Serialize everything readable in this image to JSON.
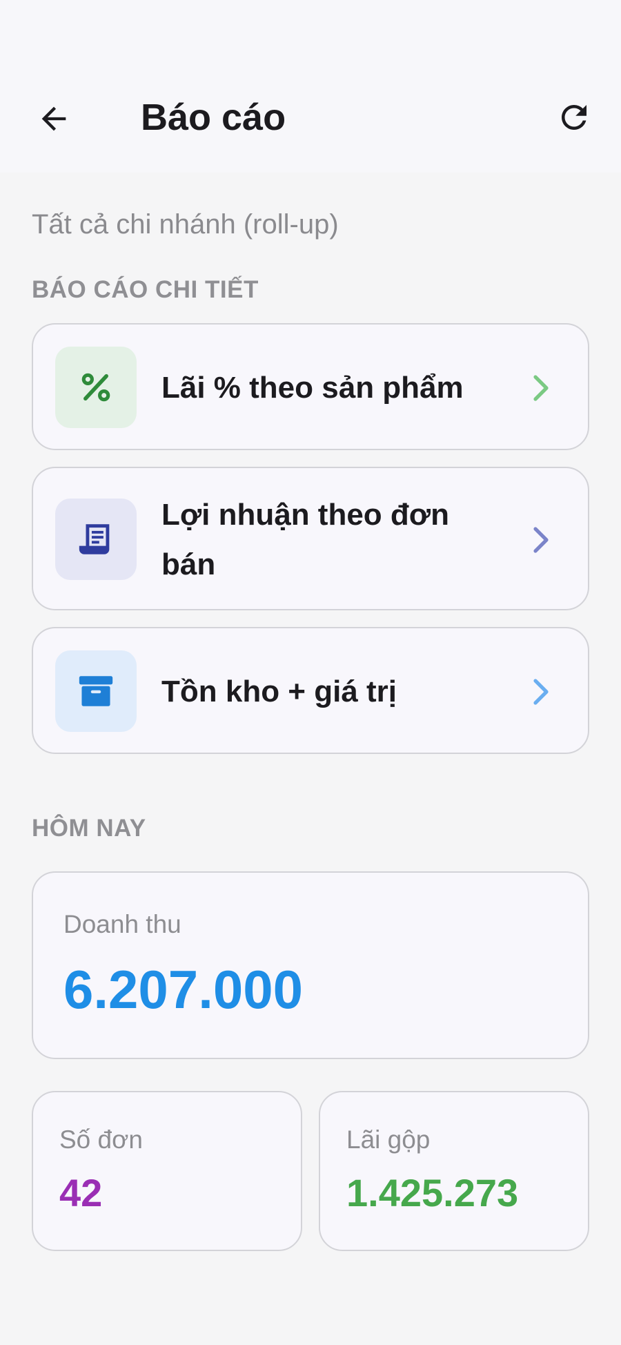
{
  "header": {
    "title": "Báo cáo",
    "back_icon": "arrow-back-icon",
    "refresh_icon": "refresh-icon"
  },
  "scope": "Tất cả chi nhánh (roll-up)",
  "detail_section": {
    "heading": "BÁO CÁO CHI TIẾT",
    "items": [
      {
        "label": "Lãi % theo sản phẩm",
        "icon": "percent-icon",
        "accent": "#2e8b3a",
        "icon_bg": "#e4f1e6",
        "chevron": "#7bc983"
      },
      {
        "label_line1": "Lợi nhuận theo đơn",
        "label_line2": "bán",
        "icon": "receipt-icon",
        "accent": "#2f3c9e",
        "icon_bg": "#e5e6f5",
        "chevron": "#7b84c9"
      },
      {
        "label": "Tồn kho + giá trị",
        "icon": "inventory-box-icon",
        "accent": "#1e7fd6",
        "icon_bg": "#e0ecfb",
        "chevron": "#6aaef0"
      }
    ]
  },
  "today_section": {
    "heading": "HÔM NAY",
    "revenue": {
      "label": "Doanh thu",
      "value": "6.207.000",
      "color": "#1f8ee6"
    },
    "orders": {
      "label": "Số đơn",
      "value": "42",
      "color": "#9a2eb4"
    },
    "gross_profit": {
      "label": "Lãi gộp",
      "value": "1.425.273",
      "color": "#46a84c"
    }
  }
}
